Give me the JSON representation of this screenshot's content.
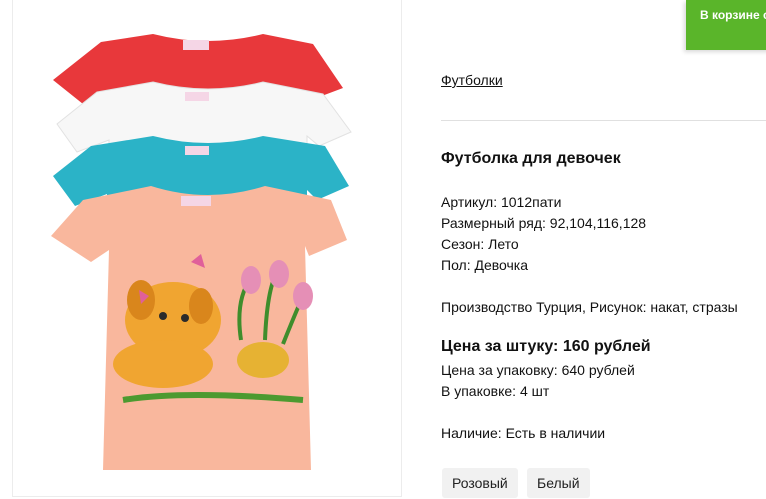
{
  "toast": {
    "text": "В корзине с"
  },
  "breadcrumb": {
    "category": "Футболки"
  },
  "product": {
    "title": "Футболка для девочек",
    "article": "Артикул: 1012пати",
    "sizes": "Размерный ряд: 92,104,116,128",
    "season": "Сезон: Лето",
    "gender": "Пол: Девочка",
    "production": "Производство Турция, Рисунок: накат, стразы",
    "price_unit": "Цена за штуку: 160 рублей",
    "price_pack": "Цена за упаковку: 640 рублей",
    "pack_qty": "В упаковке: 4 шт",
    "availability": "Наличие: Есть в наличии"
  },
  "colors": {
    "shirt_red": "#e8383b",
    "shirt_white": "#f7f7f7",
    "shirt_blue": "#2bb3c7",
    "shirt_peach": "#f9b79d",
    "toast_green": "#5ab52a"
  },
  "variants": [
    {
      "label": "Розовый"
    },
    {
      "label": "Белый"
    }
  ]
}
